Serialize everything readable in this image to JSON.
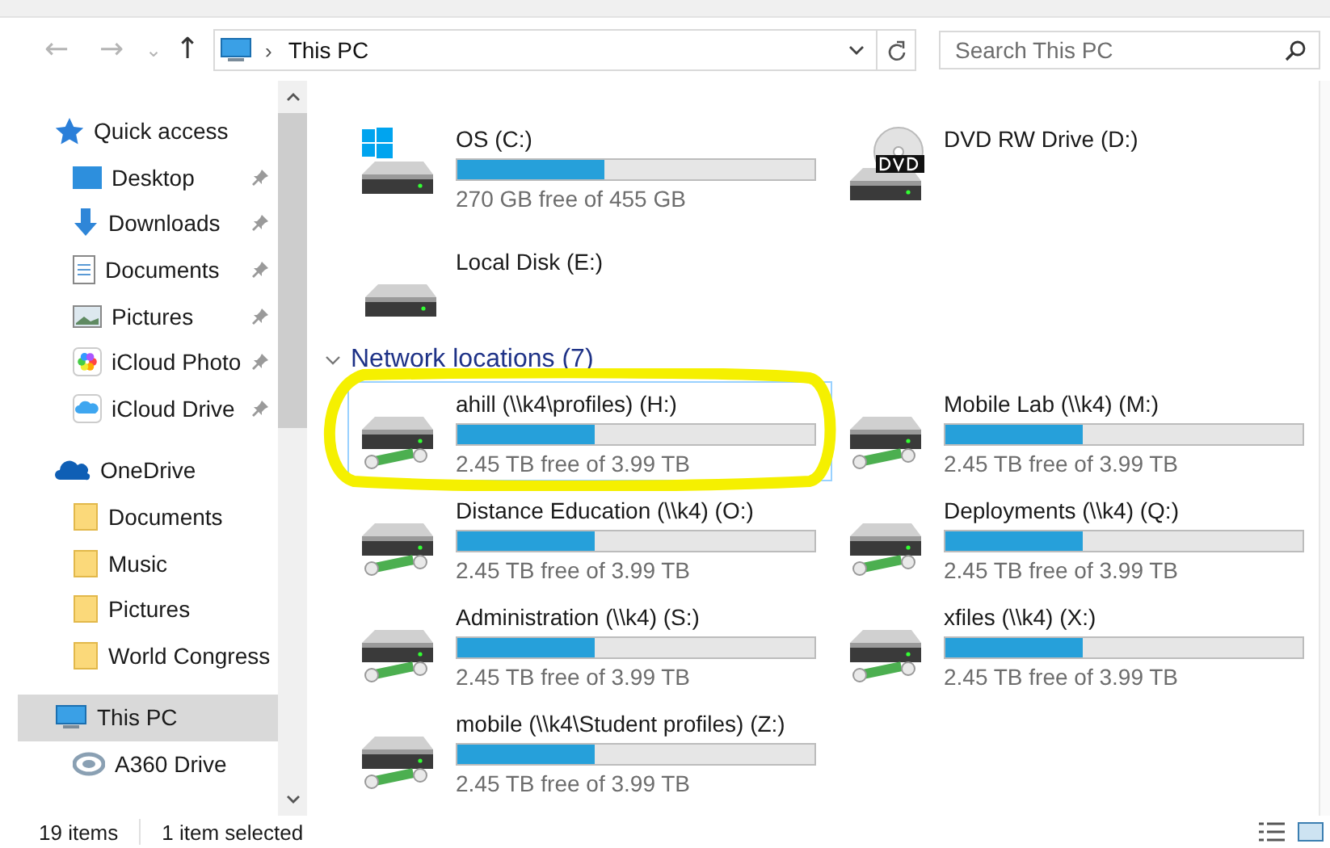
{
  "toolbar": {
    "back": "←",
    "forward": "→",
    "recent": "⌄",
    "up": "↑"
  },
  "address": {
    "separator": "›",
    "path": "This PC"
  },
  "search": {
    "placeholder": "Search This PC"
  },
  "sidebar": {
    "groups": [
      {
        "label": "Quick access",
        "selected": false,
        "children": [
          {
            "label": "Desktop",
            "pinned": true,
            "selected": false
          },
          {
            "label": "Downloads",
            "pinned": true,
            "selected": false
          },
          {
            "label": "Documents",
            "pinned": true,
            "selected": false
          },
          {
            "label": "Pictures",
            "pinned": true,
            "selected": false
          },
          {
            "label": "iCloud Photo",
            "pinned": true,
            "selected": false
          },
          {
            "label": "iCloud Drive",
            "pinned": true,
            "selected": false
          }
        ]
      },
      {
        "label": "OneDrive",
        "selected": false,
        "children": [
          {
            "label": "Documents",
            "pinned": false,
            "selected": false
          },
          {
            "label": "Music",
            "pinned": false,
            "selected": false
          },
          {
            "label": "Pictures",
            "pinned": false,
            "selected": false
          },
          {
            "label": "World Congress",
            "pinned": false,
            "selected": false
          }
        ]
      },
      {
        "label": "This PC",
        "selected": true,
        "children": [
          {
            "label": "A360 Drive",
            "pinned": false,
            "selected": false
          }
        ]
      }
    ]
  },
  "devices": [
    {
      "kind": "system",
      "name": "OS (C:)",
      "level": 0.41,
      "free": "270 GB free of 455 GB",
      "selected": false
    },
    {
      "kind": "dvd",
      "name": "DVD RW Drive (D:)",
      "selected": false
    },
    {
      "kind": "local",
      "name": "Local Disk (E:)",
      "selected": false
    }
  ],
  "network_locations": {
    "heading": "Network locations (7)",
    "expanded": true,
    "items": [
      {
        "kind": "network",
        "name": "ahill (\\\\k4\\profiles) (H:)",
        "level": 0.386,
        "free": "2.45 TB free of 3.99 TB",
        "selected": true
      },
      {
        "kind": "network",
        "name": "Mobile Lab (\\\\k4) (M:)",
        "level": 0.386,
        "free": "2.45 TB free of 3.99 TB",
        "selected": false
      },
      {
        "kind": "network",
        "name": "Distance Education (\\\\k4) (O:)",
        "level": 0.386,
        "free": "2.45 TB free of 3.99 TB",
        "selected": false
      },
      {
        "kind": "network",
        "name": "Deployments (\\\\k4) (Q:)",
        "level": 0.386,
        "free": "2.45 TB free of 3.99 TB",
        "selected": false
      },
      {
        "kind": "network",
        "name": "Administration (\\\\k4) (S:)",
        "level": 0.386,
        "free": "2.45 TB free of 3.99 TB",
        "selected": false
      },
      {
        "kind": "network",
        "name": "xfiles (\\\\k4) (X:)",
        "level": 0.386,
        "free": "2.45 TB free of 3.99 TB",
        "selected": false
      },
      {
        "kind": "network",
        "name": "mobile (\\\\k4\\Student profiles) (Z:)",
        "level": 0.386,
        "free": "2.45 TB free of 3.99 TB",
        "selected": false
      }
    ]
  },
  "status_bar": {
    "count": "19 items",
    "selection": "1 item selected"
  }
}
